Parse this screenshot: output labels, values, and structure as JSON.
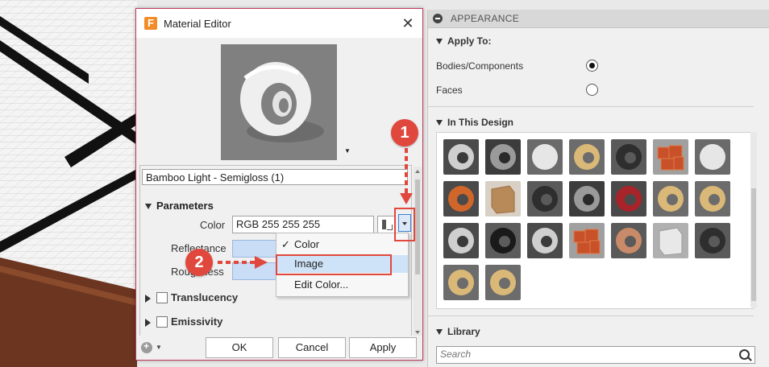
{
  "dialog": {
    "title": "Material Editor",
    "app_icon_letter": "F",
    "close_glyph": "✕",
    "material_name": "Bamboo Light - Semigloss (1)",
    "parameters_label": "Parameters",
    "color_label": "Color",
    "color_value": "RGB 255 255 255",
    "reflectance_label": "Reflectance",
    "roughness_label": "Roughness",
    "translucency_label": "Translucency",
    "emissivity_label": "Emissivity",
    "ok_label": "OK",
    "cancel_label": "Cancel",
    "apply_label": "Apply"
  },
  "menu": {
    "items": [
      {
        "label": "Color",
        "checked": true
      },
      {
        "label": "Image",
        "checked": false
      },
      {
        "label": "Edit Color...",
        "checked": false
      }
    ]
  },
  "callouts": [
    "1",
    "2"
  ],
  "appearance": {
    "header": "APPEARANCE",
    "apply_to_label": "Apply To:",
    "options": [
      {
        "label": "Bodies/Components",
        "selected": true
      },
      {
        "label": "Faces",
        "selected": false
      }
    ],
    "in_this_design_label": "In This Design",
    "library_label": "Library",
    "search_placeholder": "Search",
    "swatches": [
      "steel-ring",
      "chrome-ring",
      "white-sphere",
      "bamboo-ring",
      "dark-ring",
      "copper-blocks",
      "white-sphere",
      "orange-ring",
      "cardboard-box",
      "dark-ring",
      "chrome-ring",
      "red-ring",
      "bamboo-ring",
      "bamboo-ring",
      "steel-ring",
      "black-ring",
      "steel-ring",
      "copper-blocks",
      "copper-ring",
      "glass-cube",
      "dark-ring",
      "bamboo-ring",
      "bamboo-ring"
    ]
  },
  "colors": {
    "accent_red": "#e0483e",
    "dialog_border": "#c33a5a",
    "highlight_blue": "#cfe3f8"
  }
}
